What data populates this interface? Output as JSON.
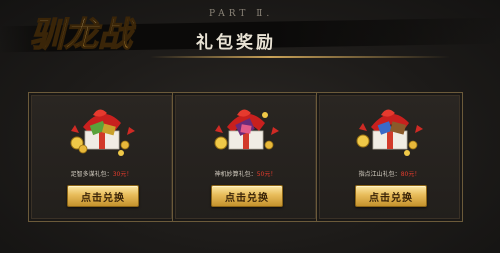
{
  "header": {
    "logo_text": "驯龙战",
    "part_label": "PART Ⅱ.",
    "section_title": "礼包奖励"
  },
  "gifts": [
    {
      "name_label": "足智多谋礼包：",
      "value": "30元！",
      "button": "点击兑换",
      "icon": "gift-box-icon"
    },
    {
      "name_label": "神机妙算礼包：",
      "value": "50元！",
      "button": "点击兑换",
      "icon": "gift-box-icon"
    },
    {
      "name_label": "指点江山礼包：",
      "value": "80元！",
      "button": "点击兑换",
      "icon": "gift-box-icon"
    }
  ],
  "colors": {
    "background": "#1d1b19",
    "gold": "#e8bc5a",
    "price_red": "#e33b2c",
    "card_border": "#6b5a3a"
  }
}
